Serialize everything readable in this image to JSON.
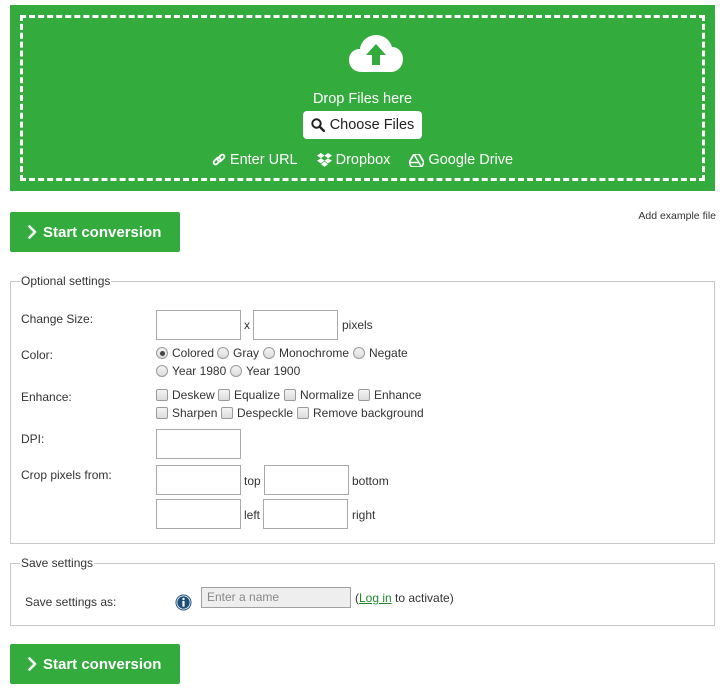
{
  "upload": {
    "drop_text": "Drop Files here",
    "choose_label": "Choose Files",
    "sources": [
      {
        "label": "Enter URL",
        "icon": "link-icon"
      },
      {
        "label": "Dropbox",
        "icon": "dropbox-icon"
      },
      {
        "label": "Google Drive",
        "icon": "google-drive-icon"
      }
    ]
  },
  "start_conversion_label": "Start conversion",
  "add_example_label": "Add example file",
  "optional": {
    "legend": "Optional settings",
    "change_size": {
      "label": "Change Size:",
      "x_text": "x",
      "unit": "pixels"
    },
    "color": {
      "label": "Color:",
      "options": [
        "Colored",
        "Gray",
        "Monochrome",
        "Negate",
        "Year 1980",
        "Year 1900"
      ],
      "selected": "Colored"
    },
    "enhance": {
      "label": "Enhance:",
      "options": [
        "Deskew",
        "Equalize",
        "Normalize",
        "Enhance",
        "Sharpen",
        "Despeckle",
        "Remove background"
      ]
    },
    "dpi": {
      "label": "DPI:"
    },
    "crop": {
      "label": "Crop pixels from:",
      "top": "top",
      "bottom": "bottom",
      "left": "left",
      "right": "right"
    }
  },
  "save": {
    "legend": "Save settings",
    "label": "Save settings as:",
    "placeholder": "Enter a name",
    "paren_open": "(",
    "login_link": "Log in",
    "suffix": " to activate)"
  },
  "colors": {
    "brand_green": "#33ab3d",
    "link_green": "#208a2a"
  }
}
